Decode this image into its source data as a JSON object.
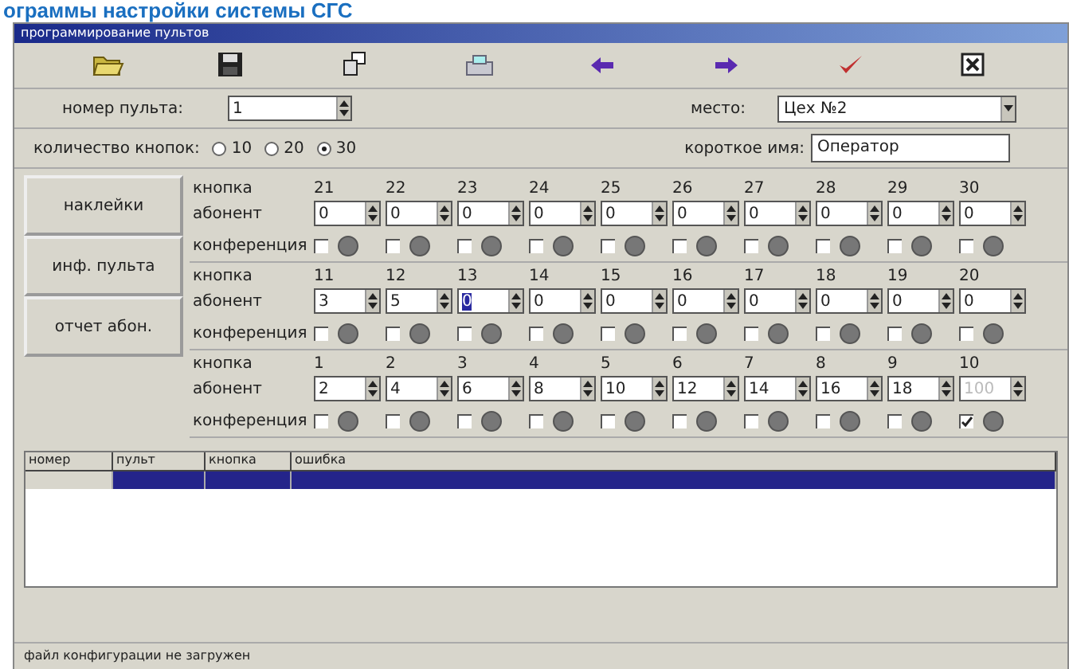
{
  "heading": "ограммы настройки системы СГС",
  "window": {
    "title": "программирование пультов"
  },
  "toolbar": [
    {
      "kind": "folder"
    },
    {
      "kind": "floppy"
    },
    {
      "kind": "copy"
    },
    {
      "kind": "printer"
    },
    {
      "kind": "arrow-left"
    },
    {
      "kind": "arrow-right"
    },
    {
      "kind": "check"
    },
    {
      "kind": "close"
    }
  ],
  "console_number": {
    "label": "номер пульта:",
    "value": "1"
  },
  "place": {
    "label": "место:",
    "value": "Цех №2"
  },
  "button_count": {
    "label": "количество кнопок:",
    "options": [
      {
        "label": "10",
        "selected": false
      },
      {
        "label": "20",
        "selected": false
      },
      {
        "label": "30",
        "selected": true
      }
    ]
  },
  "short_name": {
    "label": "короткое имя:",
    "value": "Оператор"
  },
  "side_buttons": [
    "наклейки",
    "инф. пульта",
    "отчет абон."
  ],
  "groups": [
    {
      "row_labels": {
        "button": "кнопка",
        "subscriber": "абонент",
        "conference": "конференция"
      },
      "cells": [
        {
          "number": "21",
          "subscriber": "0",
          "conference": false,
          "focused": false,
          "disabled": false
        },
        {
          "number": "22",
          "subscriber": "0",
          "conference": false,
          "focused": false,
          "disabled": false
        },
        {
          "number": "23",
          "subscriber": "0",
          "conference": false,
          "focused": false,
          "disabled": false
        },
        {
          "number": "24",
          "subscriber": "0",
          "conference": false,
          "focused": false,
          "disabled": false
        },
        {
          "number": "25",
          "subscriber": "0",
          "conference": false,
          "focused": false,
          "disabled": false
        },
        {
          "number": "26",
          "subscriber": "0",
          "conference": false,
          "focused": false,
          "disabled": false
        },
        {
          "number": "27",
          "subscriber": "0",
          "conference": false,
          "focused": false,
          "disabled": false
        },
        {
          "number": "28",
          "subscriber": "0",
          "conference": false,
          "focused": false,
          "disabled": false
        },
        {
          "number": "29",
          "subscriber": "0",
          "conference": false,
          "focused": false,
          "disabled": false
        },
        {
          "number": "30",
          "subscriber": "0",
          "conference": false,
          "focused": false,
          "disabled": false
        }
      ]
    },
    {
      "row_labels": {
        "button": "кнопка",
        "subscriber": "абонент",
        "conference": "конференция"
      },
      "cells": [
        {
          "number": "11",
          "subscriber": "3",
          "conference": false,
          "focused": false,
          "disabled": false
        },
        {
          "number": "12",
          "subscriber": "5",
          "conference": false,
          "focused": false,
          "disabled": false
        },
        {
          "number": "13",
          "subscriber": "0",
          "conference": false,
          "focused": true,
          "disabled": false
        },
        {
          "number": "14",
          "subscriber": "0",
          "conference": false,
          "focused": false,
          "disabled": false
        },
        {
          "number": "15",
          "subscriber": "0",
          "conference": false,
          "focused": false,
          "disabled": false
        },
        {
          "number": "16",
          "subscriber": "0",
          "conference": false,
          "focused": false,
          "disabled": false
        },
        {
          "number": "17",
          "subscriber": "0",
          "conference": false,
          "focused": false,
          "disabled": false
        },
        {
          "number": "18",
          "subscriber": "0",
          "conference": false,
          "focused": false,
          "disabled": false
        },
        {
          "number": "19",
          "subscriber": "0",
          "conference": false,
          "focused": false,
          "disabled": false
        },
        {
          "number": "20",
          "subscriber": "0",
          "conference": false,
          "focused": false,
          "disabled": false
        }
      ]
    },
    {
      "row_labels": {
        "button": "кнопка",
        "subscriber": "абонент",
        "conference": "конференция"
      },
      "cells": [
        {
          "number": "1",
          "subscriber": "2",
          "conference": false,
          "focused": false,
          "disabled": false
        },
        {
          "number": "2",
          "subscriber": "4",
          "conference": false,
          "focused": false,
          "disabled": false
        },
        {
          "number": "3",
          "subscriber": "6",
          "conference": false,
          "focused": false,
          "disabled": false
        },
        {
          "number": "4",
          "subscriber": "8",
          "conference": false,
          "focused": false,
          "disabled": false
        },
        {
          "number": "5",
          "subscriber": "10",
          "conference": false,
          "focused": false,
          "disabled": false
        },
        {
          "number": "6",
          "subscriber": "12",
          "conference": false,
          "focused": false,
          "disabled": false
        },
        {
          "number": "7",
          "subscriber": "14",
          "conference": false,
          "focused": false,
          "disabled": false
        },
        {
          "number": "8",
          "subscriber": "16",
          "conference": false,
          "focused": false,
          "disabled": false
        },
        {
          "number": "9",
          "subscriber": "18",
          "conference": false,
          "focused": false,
          "disabled": false
        },
        {
          "number": "10",
          "subscriber": "100",
          "conference": true,
          "focused": false,
          "disabled": true
        }
      ]
    }
  ],
  "table": {
    "columns": [
      "номер",
      "пульт",
      "кнопка",
      "ошибка"
    ],
    "rows": [
      {
        "selected": true
      }
    ]
  },
  "status_bar": "файл конфигурации не загружен"
}
